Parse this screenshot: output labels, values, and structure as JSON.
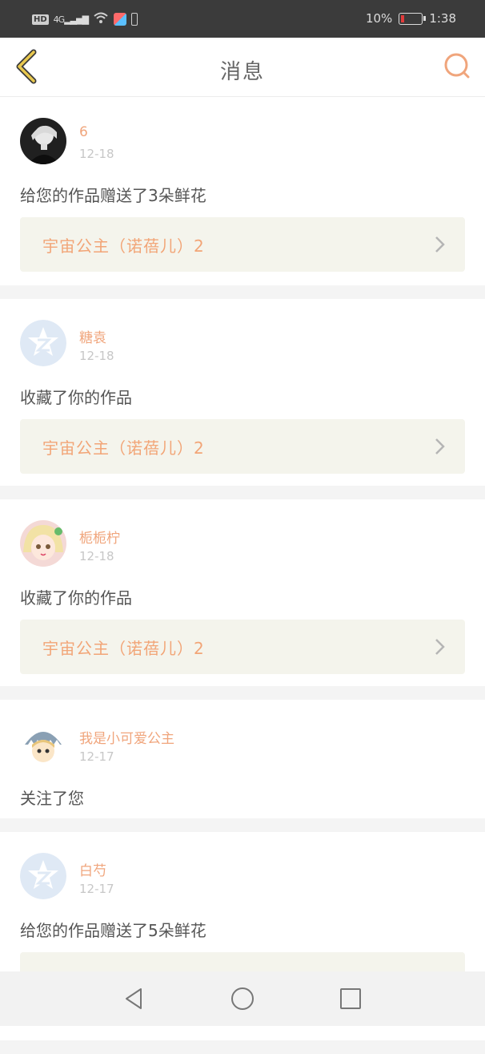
{
  "status_bar": {
    "network": "4G",
    "battery_percent": "10%",
    "time": "1:38",
    "icons": [
      "hd-icon",
      "signal-icon",
      "wifi-icon",
      "app-icon",
      "battery-small-icon",
      "battery-icon"
    ]
  },
  "header": {
    "title": "消息",
    "back_icon": "chevron-left-icon",
    "search_icon": "search-icon"
  },
  "messages": [
    {
      "user": "6",
      "date": "12-18",
      "action": "给您的作品赠送了3朵鲜花",
      "work": "宇宙公主（诺蓓儿）2",
      "avatar": "photo"
    },
    {
      "user": "糖袁",
      "date": "12-18",
      "action": "收藏了你的作品",
      "work": "宇宙公主（诺蓓儿）2",
      "avatar": "default"
    },
    {
      "user": "栀栀柠",
      "date": "12-18",
      "action": "收藏了你的作品",
      "work": "宇宙公主（诺蓓儿）2",
      "avatar": "anime-girl"
    },
    {
      "user": "我是小可爱公主",
      "date": "12-17",
      "action": "关注了您",
      "work": "",
      "avatar": "anime-shark"
    },
    {
      "user": "白芍",
      "date": "12-17",
      "action": "给您的作品赠送了5朵鲜花",
      "work": "",
      "avatar": "default"
    }
  ],
  "colors": {
    "accent": "#f0a57c",
    "back_icon": "#e0c04a",
    "work_bg": "#f4f4ec"
  },
  "nav": [
    "back-triangle-icon",
    "home-circle-icon",
    "recents-square-icon"
  ]
}
